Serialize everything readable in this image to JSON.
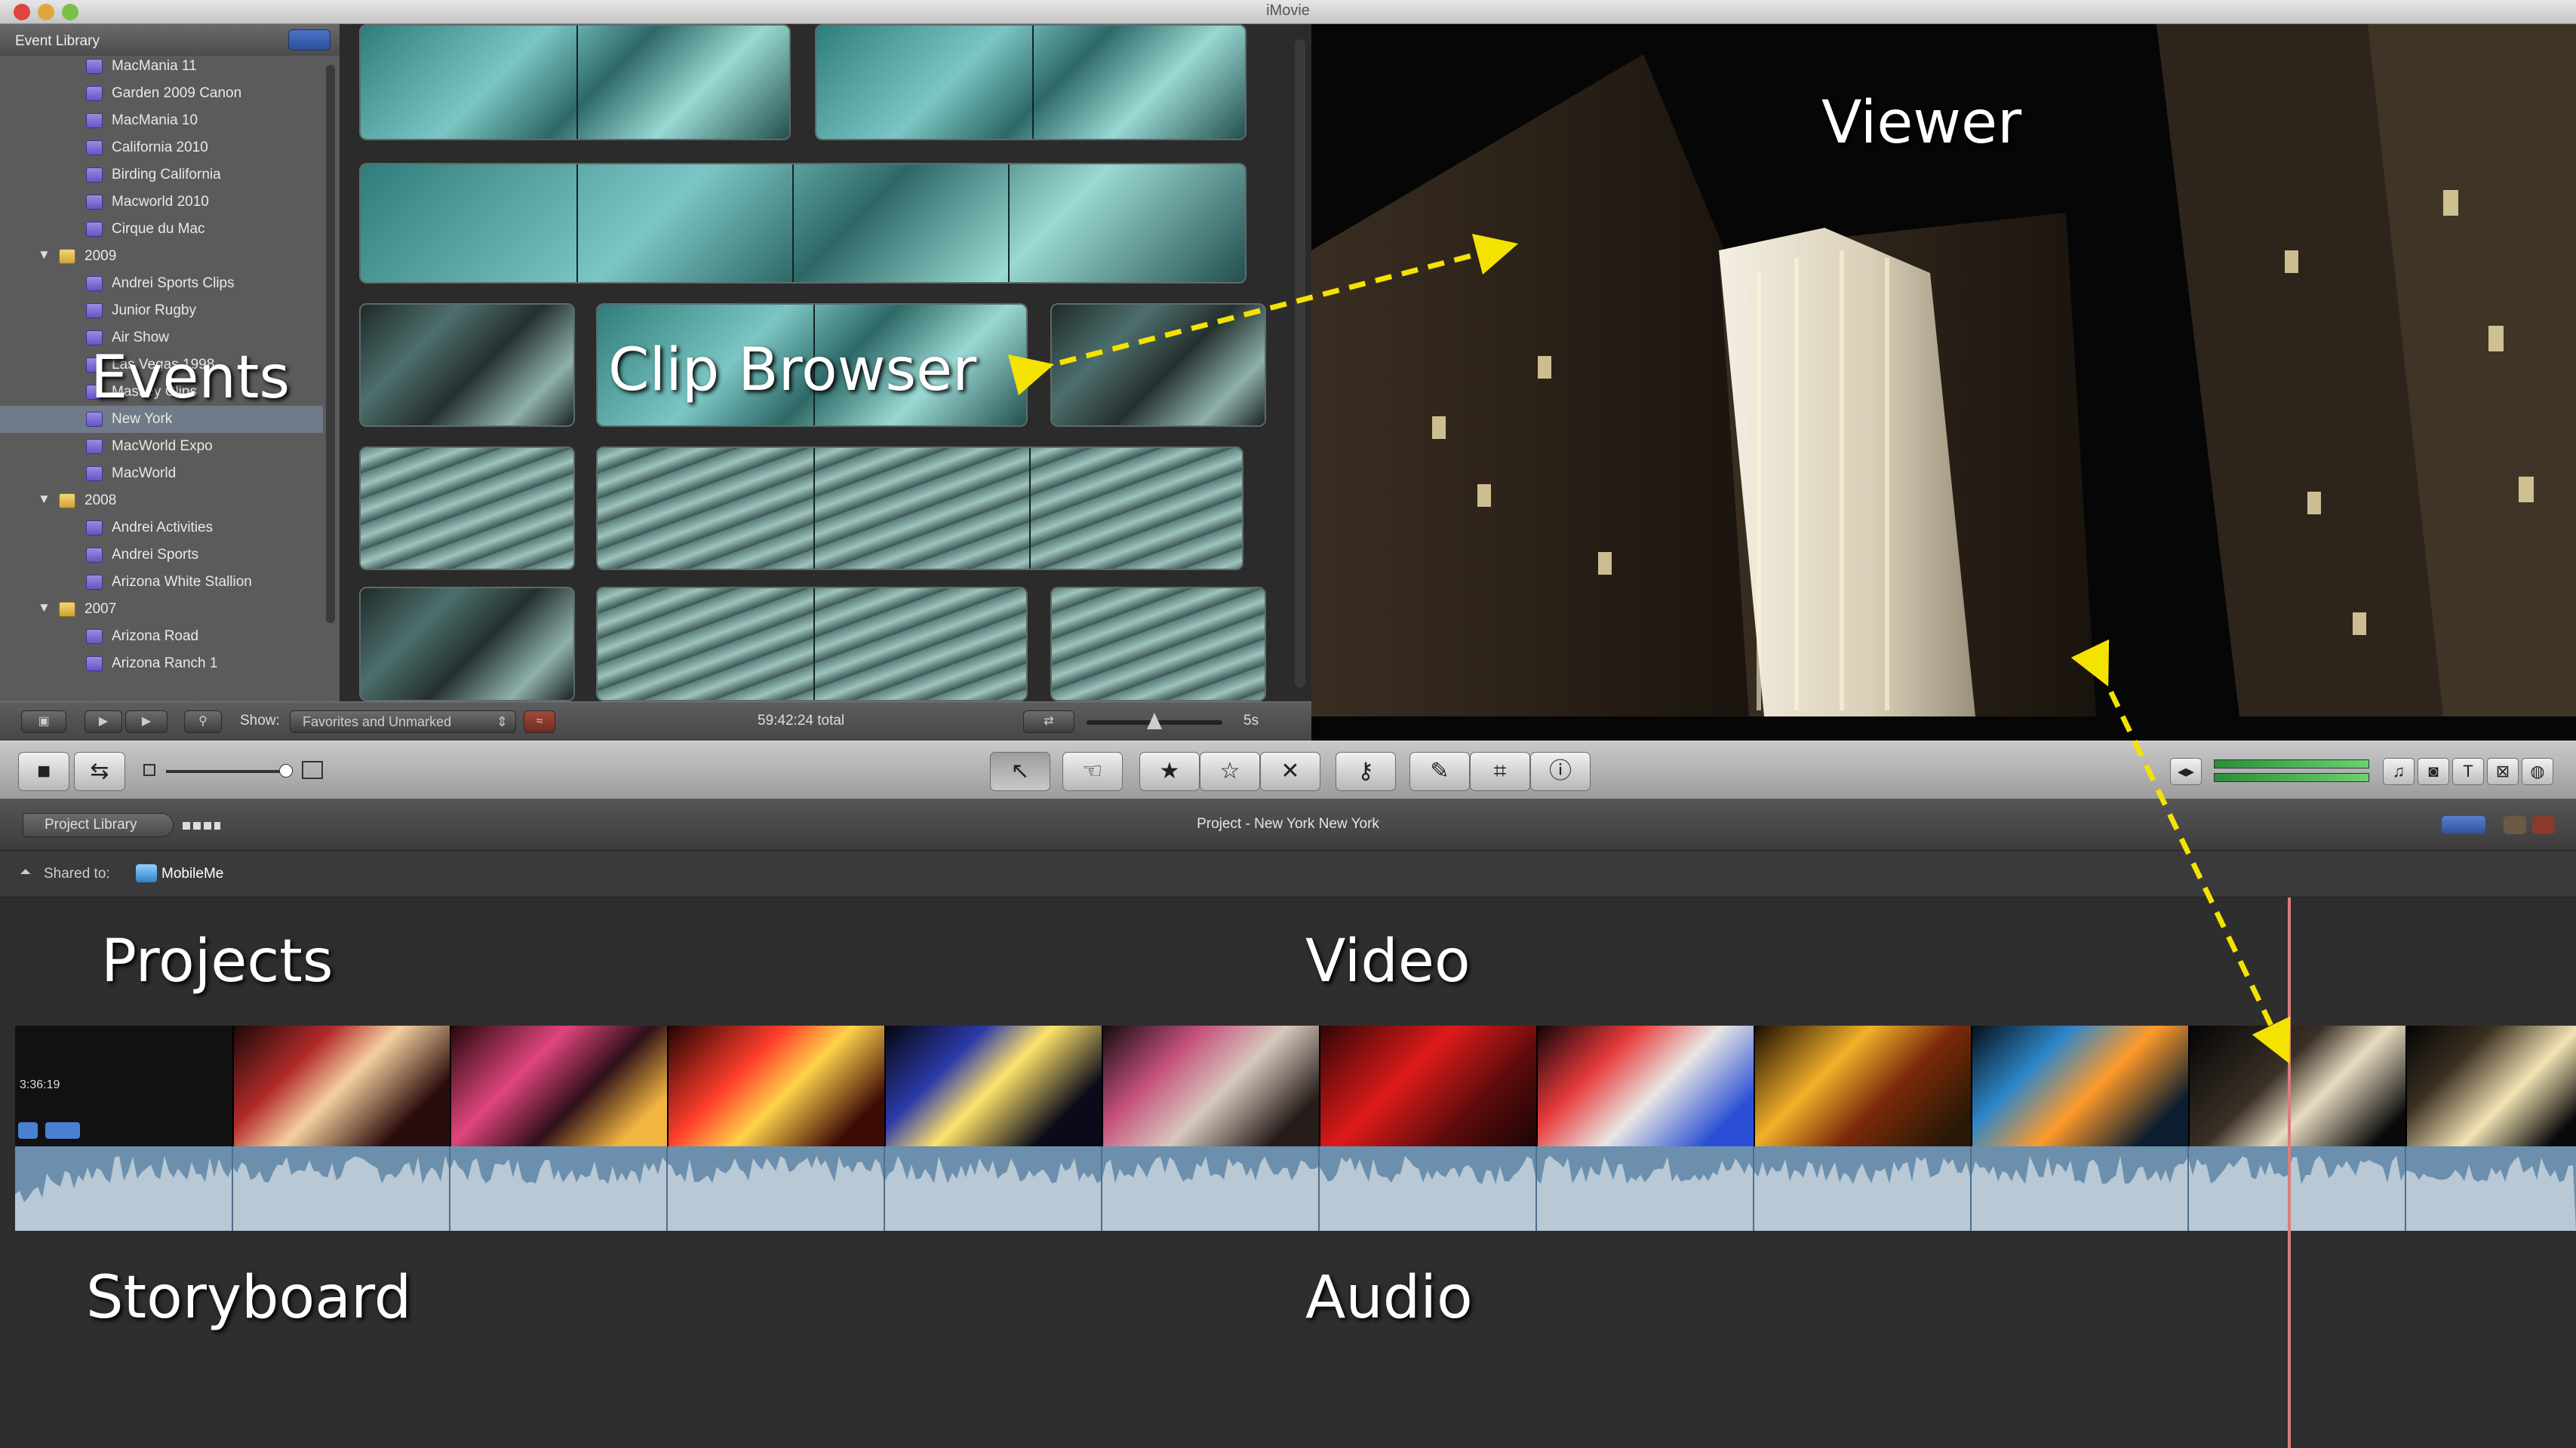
{
  "app": {
    "title": "iMovie"
  },
  "event_library": {
    "header": "Event Library",
    "items": [
      {
        "label": "MacMania 11",
        "type": "event"
      },
      {
        "label": "Garden 2009 Canon",
        "type": "event"
      },
      {
        "label": "MacMania 10",
        "type": "event"
      },
      {
        "label": "California 2010",
        "type": "event"
      },
      {
        "label": "Birding California",
        "type": "event"
      },
      {
        "label": "Macworld 2010",
        "type": "event"
      },
      {
        "label": "Cirque du Mac",
        "type": "event"
      },
      {
        "label": "2009",
        "type": "folder"
      },
      {
        "label": "Andrei Sports Clips",
        "type": "event"
      },
      {
        "label": "Junior Rugby",
        "type": "event"
      },
      {
        "label": "Air Show",
        "type": "event"
      },
      {
        "label": "Las Vegas 1998",
        "type": "event"
      },
      {
        "label": "Massey Clips",
        "type": "event"
      },
      {
        "label": "New York",
        "type": "event",
        "selected": true
      },
      {
        "label": "MacWorld Expo",
        "type": "event"
      },
      {
        "label": "MacWorld",
        "type": "event"
      },
      {
        "label": "2008",
        "type": "folder"
      },
      {
        "label": "Andrei Activities",
        "type": "event"
      },
      {
        "label": "Andrei Sports",
        "type": "event"
      },
      {
        "label": "Arizona White Stallion",
        "type": "event"
      },
      {
        "label": "2007",
        "type": "folder"
      },
      {
        "label": "Arizona Road",
        "type": "event"
      },
      {
        "label": "Arizona Ranch 1",
        "type": "event"
      }
    ]
  },
  "browser_bar": {
    "show_label": "Show:",
    "show_value": "Favorites and Unmarked",
    "total": "59:42:24 total",
    "zoom": "5s"
  },
  "toolbar": {
    "icons": [
      "camera-icon",
      "swap-icon",
      "pointer-icon",
      "hand-icon",
      "star-icon",
      "empty-star-icon",
      "reject-icon",
      "key-icon",
      "dropper-icon",
      "crop-icon",
      "info-icon",
      "music-icon",
      "photo-icon",
      "title-icon",
      "transition-icon",
      "globe-icon"
    ]
  },
  "project_bar": {
    "library_button": "Project Library",
    "title": "Project - New York New York"
  },
  "shared": {
    "label": "Shared to:",
    "service": "MobileMe"
  },
  "storyboard": {
    "duration": "3:36:19"
  },
  "annotations": {
    "events": "Events",
    "clip_browser": "Clip Browser",
    "viewer": "Viewer",
    "projects": "Projects",
    "video": "Video",
    "storyboard": "Storyboard",
    "audio": "Audio"
  },
  "colors": {
    "accent_arrow": "#f4e300",
    "playhead": "#d97e7e",
    "waveform": "#6b8fad"
  }
}
